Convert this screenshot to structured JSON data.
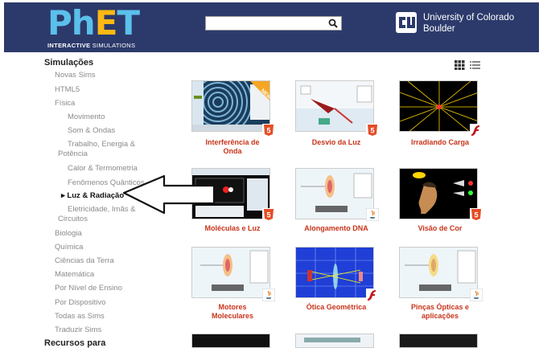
{
  "header": {
    "logo_main_ph": "Ph",
    "logo_main_e": "E",
    "logo_main_t": "T",
    "logo_sub_bold": "INTERACTIVE",
    "logo_sub_light": " SIMULATIONS",
    "search_placeholder": "",
    "university_line1": "University of Colorado",
    "university_line2": "Boulder",
    "bg_color": "#2c3a6b"
  },
  "sidebar": {
    "heading": "Simulações",
    "items": [
      {
        "label": "Novas Sims"
      },
      {
        "label": "HTML5"
      },
      {
        "label": "Física"
      },
      {
        "label": "Movimento"
      },
      {
        "label": "Som & Ondas"
      },
      {
        "label": "Trabalho, Energia &"
      },
      {
        "label": "Potência"
      },
      {
        "label": "Calor & Termometria"
      },
      {
        "label": "Fenômenos Quânticos"
      },
      {
        "label": "▸ Luz & Radiação"
      },
      {
        "label": "Eletricidade, Imãs &"
      },
      {
        "label": "Circuitos"
      },
      {
        "label": "Biologia"
      },
      {
        "label": "Química"
      },
      {
        "label": "Ciências da Terra"
      },
      {
        "label": "Matemática"
      },
      {
        "label": "Por Nível de Ensino"
      },
      {
        "label": "Por Dispositivo"
      },
      {
        "label": "Todas as Sims"
      },
      {
        "label": "Traduzir Sims"
      }
    ],
    "heading2": "Recursos para"
  },
  "sims": [
    {
      "line1": "Interferência de",
      "line2": "Onda",
      "badge": "html5-icon",
      "new": "NEW!"
    },
    {
      "line1": "Desvio da Luz",
      "line2": "",
      "badge": "html5-icon"
    },
    {
      "line1": "Irradiando Carga",
      "line2": "",
      "badge": "flash-icon"
    },
    {
      "line1": "Moléculas e Luz",
      "line2": "",
      "badge": "html5-icon"
    },
    {
      "line1": "Alongamento DNA",
      "line2": "",
      "badge": "java-icon"
    },
    {
      "line1": "Visão de Cor",
      "line2": "",
      "badge": "html5-icon"
    },
    {
      "line1": "Motores",
      "line2": "Moleculares",
      "badge": "java-icon"
    },
    {
      "line1": "Ótica Geométrica",
      "line2": "",
      "badge": "flash-icon"
    },
    {
      "line1": "Pinças Ópticas e",
      "line2": "aplicações",
      "badge": "java-icon"
    }
  ],
  "colors": {
    "label_red": "#c8341a",
    "html5_orange": "#e44d26",
    "flash_red": "#c4161c"
  }
}
